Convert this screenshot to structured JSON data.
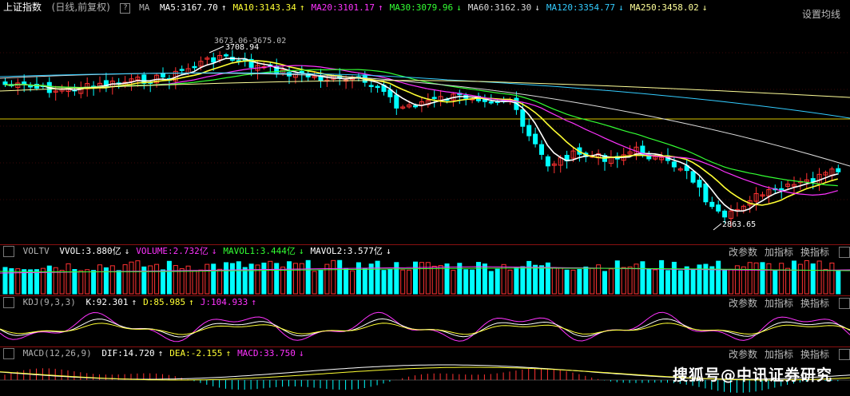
{
  "main": {
    "index_name": "上证指数",
    "period_info": "(日线,前复权)",
    "help": "?",
    "indicator": "MA",
    "ma": [
      {
        "label": "MA5:3167.70",
        "color": "#ffffff",
        "arrow": "↑"
      },
      {
        "label": "MA10:3143.34",
        "color": "#ffff33",
        "arrow": "↑"
      },
      {
        "label": "MA20:3101.17",
        "color": "#ff33ff",
        "arrow": "↑"
      },
      {
        "label": "MA30:3079.96",
        "color": "#33ff33",
        "arrow": "↓"
      },
      {
        "label": "MA60:3162.30",
        "color": "#dcdcdc",
        "arrow": "↓"
      },
      {
        "label": "MA120:3354.77",
        "color": "#33ccff",
        "arrow": "↓"
      },
      {
        "label": "MA250:3458.02",
        "color": "#ffff99",
        "arrow": "↓"
      }
    ],
    "settings": "设置均线",
    "annotation_high": "3708.94",
    "annotation_high2": "3673.06-3675.02",
    "annotation_low": "2863.65"
  },
  "volume": {
    "name": "VOLTV",
    "items": [
      {
        "label": "VVOL:3.880亿",
        "color": "#ffffff",
        "arrow": "↓"
      },
      {
        "label": "VOLUME:2.732亿",
        "color": "#ff33ff",
        "arrow": "↓"
      },
      {
        "label": "MAVOL1:3.444亿",
        "color": "#33ff33",
        "arrow": "↓"
      },
      {
        "label": "MAVOL2:3.577亿",
        "color": "#ffffff",
        "arrow": "↓"
      }
    ]
  },
  "kdj": {
    "name": "KDJ(9,3,3)",
    "items": [
      {
        "label": "K:92.301",
        "color": "#ffffff",
        "arrow": "↑"
      },
      {
        "label": "D:85.985",
        "color": "#ffff33",
        "arrow": "↑"
      },
      {
        "label": "J:104.933",
        "color": "#ff33ff",
        "arrow": "↑"
      }
    ]
  },
  "macd": {
    "name": "MACD(12,26,9)",
    "items": [
      {
        "label": "DIF:14.720",
        "color": "#ffffff",
        "arrow": "↑"
      },
      {
        "label": "DEA:-2.155",
        "color": "#ffff33",
        "arrow": "↑"
      },
      {
        "label": "MACD:33.750",
        "color": "#ff33ff",
        "arrow": "↓"
      }
    ]
  },
  "panel_buttons": {
    "params": "改参数",
    "add": "加指标",
    "swap": "换指标"
  },
  "watermark": "搜狐号@中讯证券研究",
  "colors": {
    "up": "#ff3232",
    "down": "#00ffff",
    "grid": "#8a1010"
  }
}
